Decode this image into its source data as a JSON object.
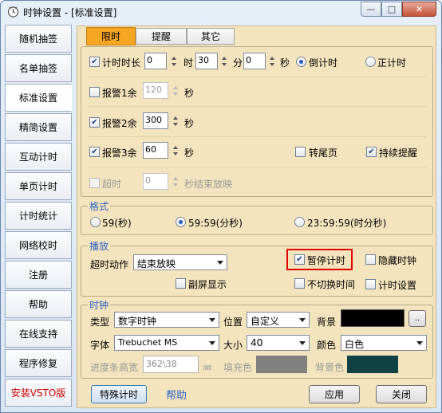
{
  "window": {
    "title": "时钟设置 - [标准设置]"
  },
  "title_buttons": {
    "minimize": "—",
    "maximize": "□",
    "close": "✕"
  },
  "sidebar": {
    "items": [
      {
        "label": "随机抽签"
      },
      {
        "label": "名单抽签"
      },
      {
        "label": "标准设置"
      },
      {
        "label": "精简设置"
      },
      {
        "label": "互动计时"
      },
      {
        "label": "单页计时"
      },
      {
        "label": "计时统计"
      },
      {
        "label": "网络校时"
      },
      {
        "label": "注册"
      },
      {
        "label": "帮助"
      },
      {
        "label": "在线支持"
      },
      {
        "label": "程序修复"
      },
      {
        "label": "安装VSTO版"
      }
    ]
  },
  "tabs": [
    {
      "label": "限时"
    },
    {
      "label": "提醒"
    },
    {
      "label": "其它"
    }
  ],
  "timer": {
    "duration_label": "计时时长",
    "hours": "0",
    "hours_unit": "时",
    "minutes": "30",
    "minutes_unit": "分",
    "seconds": "0",
    "seconds_unit": "秒",
    "countdown_label": "倒计时",
    "countup_label": "正计时"
  },
  "alerts": {
    "alert1": {
      "label": "报警1余",
      "value": "120",
      "unit": "秒"
    },
    "alert2": {
      "label": "报警2余",
      "value": "300",
      "unit": "秒"
    },
    "alert3": {
      "label": "报警3余",
      "value": "60",
      "unit": "秒"
    },
    "flip_page_label": "转尾页",
    "continuous_label": "持续提醒",
    "overtime_label": "超时",
    "overtime_value": "0",
    "overtime_suffix": "秒结束放映"
  },
  "format": {
    "legend": "格式",
    "opt1": "59(秒)",
    "opt2": "59:59(分秒)",
    "opt3": "23:59:59(时分秒)"
  },
  "playback": {
    "legend": "播放",
    "timeout_action_label": "超时动作",
    "timeout_action_value": "结束放映",
    "pause_label": "暂停计时",
    "hide_label": "隐藏时钟",
    "secondary_screen_label": "副屏显示",
    "no_switch_label": "不切换时间",
    "timer_settings_label": "计时设置"
  },
  "clock": {
    "legend": "时钟",
    "type_label": "类型",
    "type_value": "数字时钟",
    "position_label": "位置",
    "position_value": "自定义",
    "background_label": "背景",
    "background_color": "#000000",
    "browse_label": "..",
    "font_label": "字体",
    "font_value": "Trebuchet MS",
    "size_label": "大小",
    "size_value": "40",
    "color_label": "颜色",
    "color_value": "白色",
    "progress_label": "进度条高宽",
    "progress_value": "362\\38",
    "progress_unit": "㎜",
    "fill_label": "填充色",
    "fill_color": "#808080",
    "bg_label": "背景色",
    "bg_color": "#0e4245"
  },
  "footer": {
    "special_timer": "特殊计时",
    "help": "帮助",
    "apply": "应用",
    "close": "关闭"
  },
  "colors": {
    "accent": "#2a62c8",
    "tab_active": "#f5a623",
    "highlight": "#e00000"
  }
}
